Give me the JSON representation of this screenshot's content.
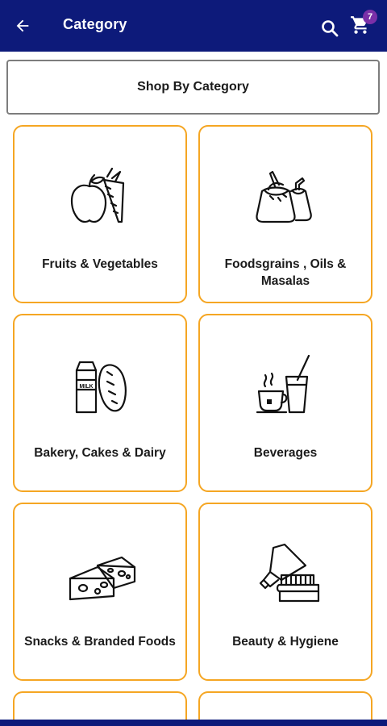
{
  "appbar": {
    "title": "Category",
    "back_icon": "arrow-left-icon",
    "search_icon": "search-icon",
    "cart_icon": "cart-icon",
    "cart_count": "7",
    "background": "#0d1a7a",
    "badge_color": "#7a2fa8"
  },
  "shop_by_category": "Shop By Category",
  "accent_color": "#f5a623",
  "categories": [
    {
      "label": "Fruits & Vegetables",
      "icon": "fruits-vegetables-icon"
    },
    {
      "label": "Foodsgrains , Oils & Masalas",
      "icon": "foodgrains-sacks-icon"
    },
    {
      "label": "Bakery, Cakes & Dairy",
      "icon": "milk-bread-icon"
    },
    {
      "label": "Beverages",
      "icon": "cup-glass-icon"
    },
    {
      "label": "Snacks & Branded Foods",
      "icon": "cheese-icon"
    },
    {
      "label": "Beauty & Hygiene",
      "icon": "toothpaste-brush-icon"
    }
  ]
}
